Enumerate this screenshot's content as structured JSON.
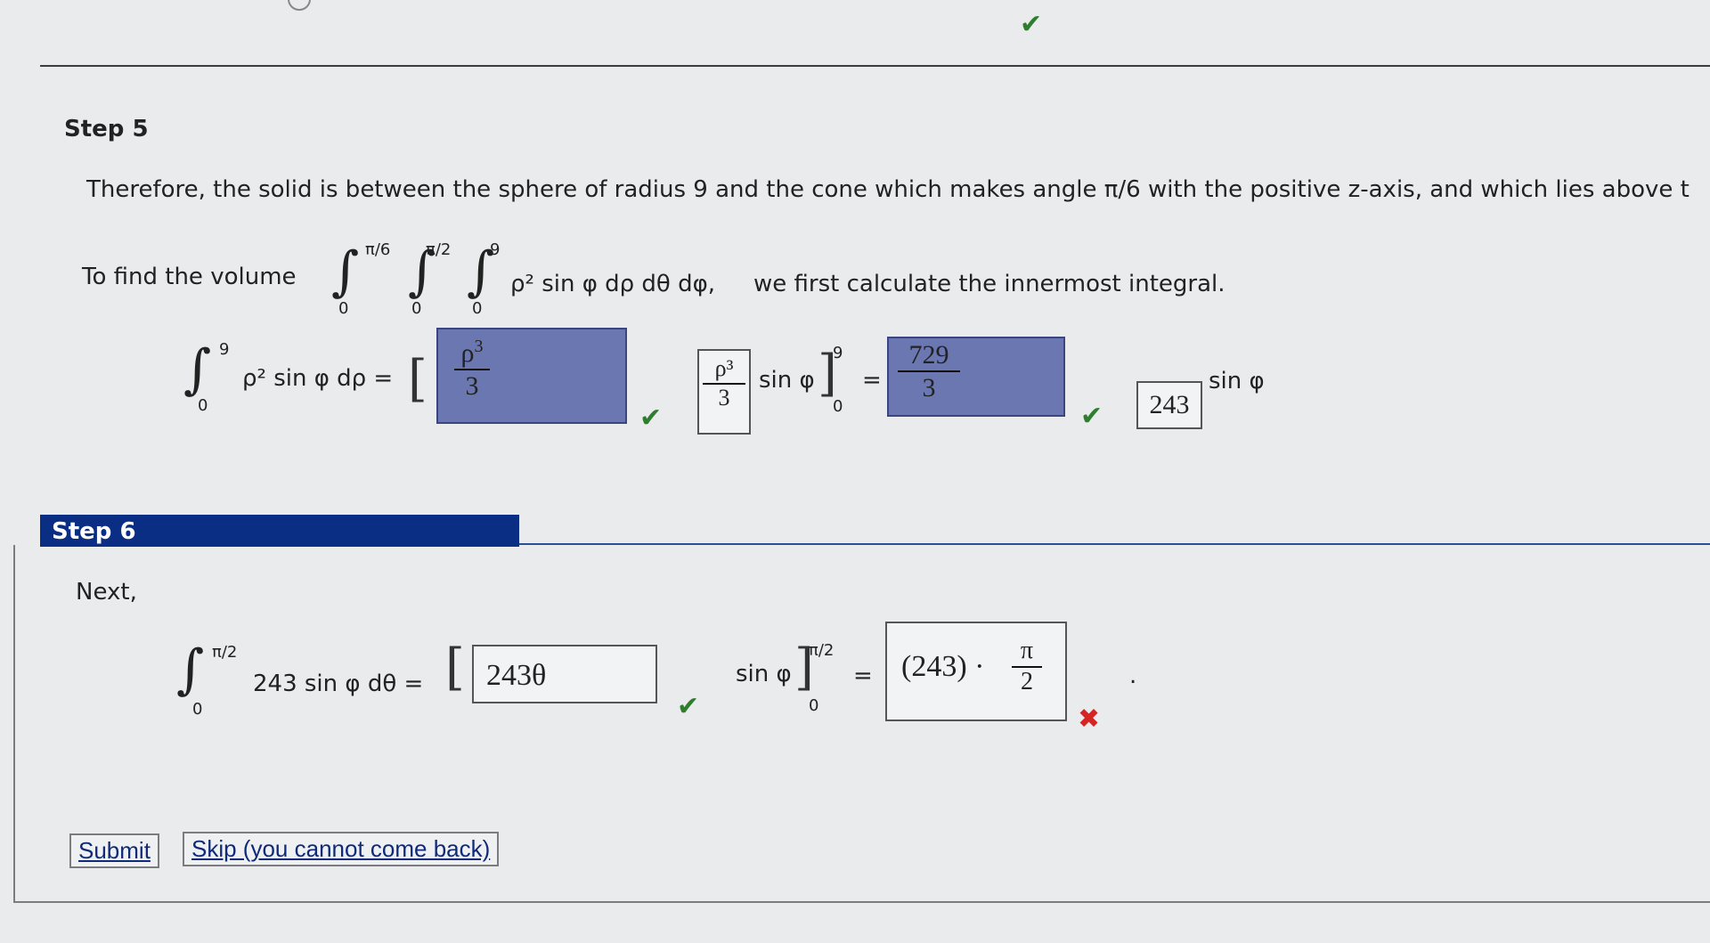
{
  "step5": {
    "label": "Step 5",
    "sentence": "Therefore, the solid is between the sphere of radius 9 and the cone which makes angle π/6 with the positive z-axis, and which lies above t",
    "volume_intro": "To find the volume",
    "triple_integral": {
      "upper1": "π/6",
      "lower1": "0",
      "upper2": "π/2",
      "lower2": "0",
      "upper3": "9",
      "lower3": "0",
      "integrand": "ρ² sin φ dρ dθ dφ,"
    },
    "volume_tail": "we first calculate the innermost integral.",
    "inner_integral": {
      "upper": "9",
      "lower": "0",
      "integrand": "ρ² sin φ dρ =",
      "answer1_num": "ρ",
      "answer1_exp": "3",
      "answer1_den": "3",
      "frac_num": "ρ³",
      "frac_den": "3",
      "sin_label": "sin φ",
      "eval_upper": "9",
      "eval_lower": "0",
      "equals": "=",
      "answer2_num": "729",
      "answer2_den": "3",
      "answer3": "243",
      "answer3_tail": "sin φ"
    }
  },
  "step6": {
    "label": "Step 6",
    "next": "Next,",
    "integral": {
      "upper": "π/2",
      "lower": "0",
      "integrand": "243 sin φ dθ =",
      "answer1": "243θ",
      "sin_label": "sin φ",
      "eval_upper": "π/2",
      "eval_lower": "0",
      "equals": "=",
      "answer2_prefix": "(243) ·",
      "answer2_num": "π",
      "answer2_den": "2",
      "period": "."
    }
  },
  "buttons": {
    "submit": "Submit",
    "skip": "Skip (you cannot come back)"
  }
}
